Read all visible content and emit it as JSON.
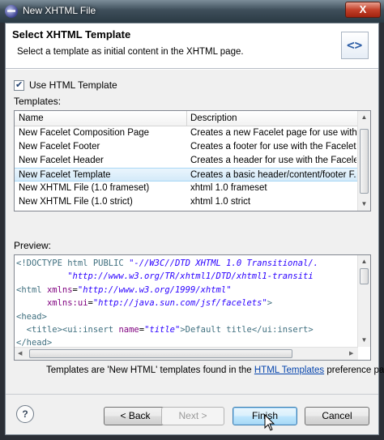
{
  "window": {
    "title": "New XHTML File",
    "close_glyph": "X"
  },
  "banner": {
    "title": "Select XHTML Template",
    "description": "Select a template as initial content in the XHTML page.",
    "icon": "xhtml-wizard-icon",
    "icon_glyph": "<>"
  },
  "use_template": {
    "label": "Use HTML Template",
    "checked": true
  },
  "templates": {
    "label": "Templates:",
    "columns": [
      "Name",
      "Description"
    ],
    "rows": [
      {
        "name": "New Facelet Composition Page",
        "description": "Creates a new Facelet page for use with ..."
      },
      {
        "name": "New Facelet Footer",
        "description": "Creates a footer for use with the Facelet ..."
      },
      {
        "name": "New Facelet Header",
        "description": "Creates a header for use with the Facelet ..."
      },
      {
        "name": "New Facelet Template",
        "description": "Creates a basic header/content/footer F..."
      },
      {
        "name": "New XHTML File (1.0 frameset)",
        "description": "xhtml 1.0 frameset"
      },
      {
        "name": "New XHTML File (1.0 strict)",
        "description": "xhtml 1.0 strict"
      }
    ],
    "selected_row": "New Facelet Template"
  },
  "preview": {
    "label": "Preview:",
    "lines": {
      "l1a": "<!DOCTYPE html PUBLIC ",
      "l1b": "\"-//W3C//DTD XHTML 1.0 Transitional/.",
      "l2": "\"http://www.w3.org/TR/xhtml1/DTD/xhtml1-transiti",
      "l3a": "<html ",
      "l3b": "xmlns",
      "l3c": "=",
      "l3d": "\"http://www.w3.org/1999/xhtml\"",
      "l4a": "xmlns:ui",
      "l4b": "=",
      "l4c": "\"http://java.sun.com/jsf/facelets\"",
      "l4d": ">",
      "l5": "<head>",
      "l6a": "<title><ui:insert ",
      "l6b": "name",
      "l6c": "=",
      "l6d": "\"title\"",
      "l6e": ">Default title</ui:insert>",
      "l7": "</head>"
    }
  },
  "info": {
    "before": "Templates are 'New HTML' templates found in the ",
    "link": "HTML Templates",
    "after": " preference page."
  },
  "buttons": {
    "help": "?",
    "back": "< Back",
    "next": "Next >",
    "finish": "Finish",
    "cancel": "Cancel"
  }
}
